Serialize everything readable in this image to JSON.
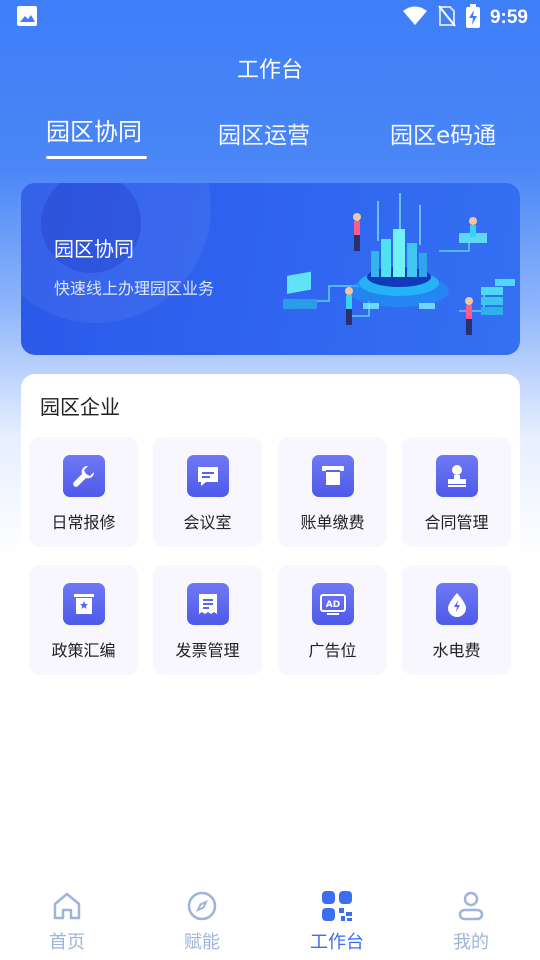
{
  "status_bar": {
    "time": "9:59",
    "icons": [
      "image-icon",
      "wifi-icon",
      "no-sim-icon",
      "battery-charging-icon"
    ]
  },
  "header": {
    "title": "工作台"
  },
  "tabs": [
    {
      "label": "园区协同",
      "active": true
    },
    {
      "label": "园区运营",
      "active": false
    },
    {
      "label": "园区e码通",
      "active": false
    }
  ],
  "banner": {
    "title": "园区协同",
    "subtitle": "快速线上办理园区业务"
  },
  "enterprise": {
    "title": "园区企业",
    "items": [
      {
        "label": "日常报修",
        "icon": "wrench-icon"
      },
      {
        "label": "会议室",
        "icon": "chat-icon"
      },
      {
        "label": "账单缴费",
        "icon": "bill-icon"
      },
      {
        "label": "合同管理",
        "icon": "stamp-icon"
      },
      {
        "label": "政策汇编",
        "icon": "policy-icon"
      },
      {
        "label": "发票管理",
        "icon": "invoice-icon"
      },
      {
        "label": "广告位",
        "icon": "ad-icon"
      },
      {
        "label": "水电费",
        "icon": "water-electric-icon"
      }
    ]
  },
  "bottom_nav": [
    {
      "label": "首页",
      "icon": "home-icon",
      "active": false
    },
    {
      "label": "赋能",
      "icon": "compass-icon",
      "active": false
    },
    {
      "label": "工作台",
      "icon": "workbench-icon",
      "active": true
    },
    {
      "label": "我的",
      "icon": "user-icon",
      "active": false
    }
  ],
  "colors": {
    "primary": "#3d6df0",
    "icon_bg": "#5a64ee",
    "nav_inactive": "#9eb4d8"
  }
}
